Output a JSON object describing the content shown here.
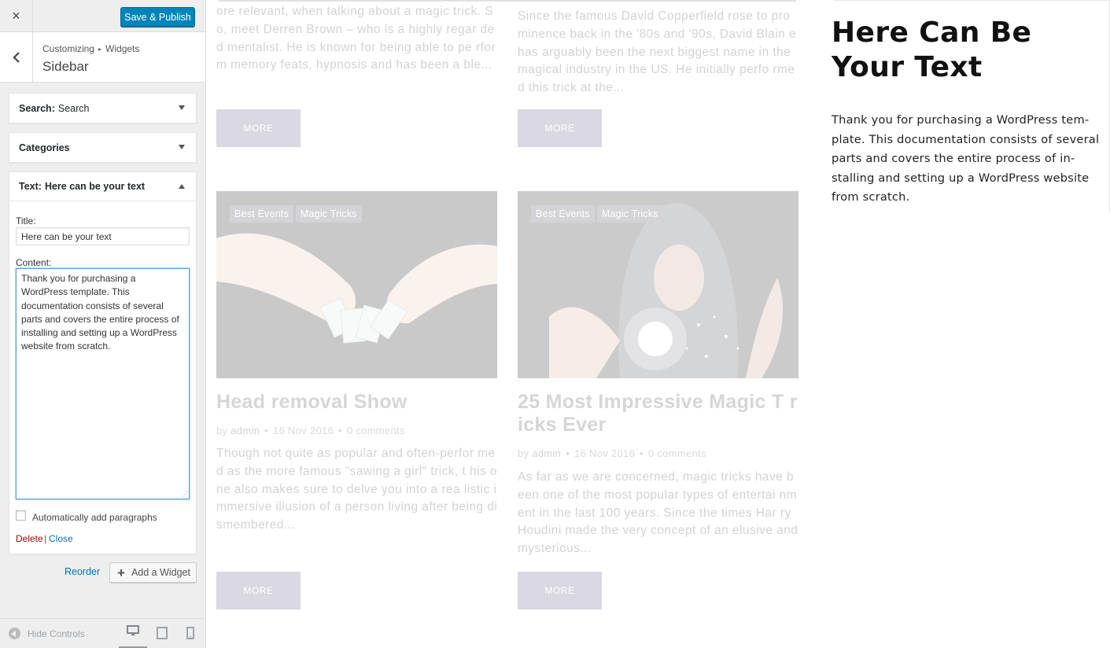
{
  "header": {
    "close_icon": "×",
    "save_label": "Save & Publish"
  },
  "nav": {
    "crumb_root": "Customizing",
    "crumb_sep": "▸",
    "crumb_current": "Widgets",
    "section_title": "Sidebar"
  },
  "widgets": {
    "search": {
      "type": "Search:",
      "name": "Search"
    },
    "categories": {
      "type": "Categories"
    },
    "text": {
      "type": "Text:",
      "name": "Here can be your text",
      "title_label": "Title:",
      "title_value": "Here can be your text",
      "content_label": "Content:",
      "content_value": "Thank you for purchasing a WordPress template. This documentation consists of several parts and covers the entire process of installing and setting up a WordPress website from scratch.",
      "auto_paragraphs_label": "Automatically add paragraphs",
      "auto_paragraphs_checked": false,
      "delete_label": "Delete",
      "separator": "|",
      "close_label": "Close"
    }
  },
  "actions": {
    "reorder_label": "Reorder",
    "add_widget_icon": "+",
    "add_widget_label": "Add a Widget"
  },
  "footer": {
    "hide_controls_label": "Hide Controls",
    "devices": [
      "desktop-icon",
      "tablet-icon",
      "mobile-icon"
    ]
  },
  "preview": {
    "posts_top": [
      {
        "excerpt": "ore relevant, when talking about a magic trick. So, meet Derren Brown – who is a highly regar ded mentalist. He is known for being able to pe rform memory feats, hypnosis and has been a ble...",
        "more_label": "MORE"
      },
      {
        "excerpt": "Since the famous David Copperfield rose to pro minence back in the '80s and '90s, David Blain e has arguably been the next biggest name in the magical industry in the US. He initially perfo rmed this trick at the...",
        "more_label": "MORE"
      }
    ],
    "posts": [
      {
        "tags": [
          "Best Events",
          "Magic Tricks"
        ],
        "title": "Head removal Show",
        "meta_by": "by",
        "meta_author": "admin",
        "meta_date": "16 Nov 2016",
        "meta_comments": "0 comments",
        "excerpt": "Though not quite as popular and often-perfor med as the more famous \"sawing a girl\" trick, t his one also makes sure to delve you into a rea listic immersive illusion of a person living after being dismembered...",
        "more_label": "MORE"
      },
      {
        "tags": [
          "Best Events",
          "Magic Tricks"
        ],
        "title": "25 Most Impressive Magic T ricks Ever",
        "meta_by": "by",
        "meta_author": "admin",
        "meta_date": "16 Nov 2016",
        "meta_comments": "0 comments",
        "excerpt": "As far as we are concerned, magic tricks have been one of the most popular types of entertai nment in the last 100 years. Since the times Har ry Houdini made the very concept of an elusive and mysterious...",
        "more_label": "MORE"
      }
    ],
    "sidebar_widget": {
      "heading": "Here Can Be Your Text",
      "text": "Thank you for purchasing a WordPress tem-plate. This documentation consists of several parts and covers the entire process of in-stalling and setting up a WordPress website from scratch."
    }
  },
  "colors": {
    "primary_button": "#0085ba",
    "link": "#0073aa",
    "delete": "#aa0000",
    "more_button": "#59507e"
  }
}
